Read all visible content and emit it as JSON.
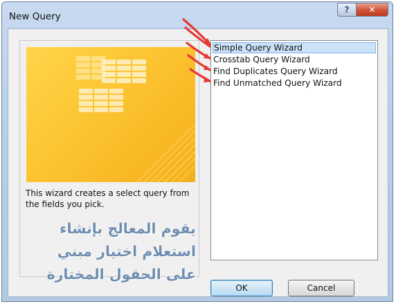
{
  "window": {
    "title": "New Query",
    "help_glyph": "?",
    "close_glyph": "✕"
  },
  "wizard": {
    "description": "This wizard creates a select query from the fields you pick."
  },
  "annotation": {
    "arabic_lines": [
      "يقوم المعالج بإنشاء",
      "استعلام اختيار مبني",
      "على الحقول المختارة"
    ]
  },
  "query_types": {
    "items": [
      "Simple Query Wizard",
      "Crosstab Query Wizard",
      "Find Duplicates Query Wizard",
      "Find Unmatched Query Wizard"
    ],
    "selected_index": 0
  },
  "buttons": {
    "ok": "OK",
    "cancel": "Cancel"
  },
  "colors": {
    "art_yellow": "#fbc02d",
    "annotation_arrows": "#e53935",
    "selection": "#cde3fa"
  }
}
